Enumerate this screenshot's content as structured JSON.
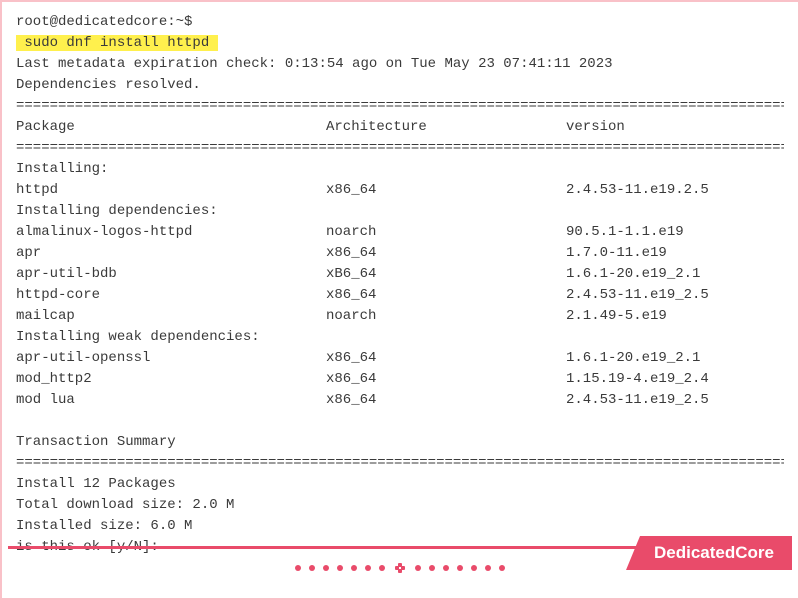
{
  "prompt": "root@dedicatedcore:~$",
  "command": " sudo dnf install httpd ",
  "meta_line": "Last metadata expiration check: 0:13:54 ago on Tue May 23 07:41:11 2023",
  "deps_resolved": "Dependencies resolved.",
  "headers": {
    "pkg": "Package",
    "arch": "Architecture",
    "ver": "version"
  },
  "sections": {
    "installing": "Installing:",
    "installing_deps": "Installing dependencies:",
    "installing_weak": "Installing weak dependencies:"
  },
  "rows_main": [
    {
      "pkg": "httpd",
      "arch": "x86_64",
      "ver": "2.4.53-11.e19.2.5"
    }
  ],
  "rows_deps": [
    {
      "pkg": "almalinux-logos-httpd",
      "arch": "noarch",
      "ver": "90.5.1-1.1.e19"
    },
    {
      "pkg": "apr",
      "arch": "x86_64",
      "ver": "1.7.0-11.e19"
    },
    {
      "pkg": "apr-util-bdb",
      "arch": "xB6_64",
      "ver": "1.6.1-20.e19_2.1"
    },
    {
      "pkg": "httpd-core",
      "arch": "x86_64",
      "ver": "2.4.53-11.e19_2.5"
    },
    {
      "pkg": "mailcap",
      "arch": "noarch",
      "ver": "2.1.49-5.e19"
    }
  ],
  "rows_weak": [
    {
      "pkg": "apr-util-openssl",
      "arch": "x86_64",
      "ver": "1.6.1-20.e19_2.1"
    },
    {
      "pkg": "mod_http2",
      "arch": "x86_64",
      "ver": "1.15.19-4.e19_2.4"
    },
    {
      "pkg": "mod lua",
      "arch": "x86_64",
      "ver": "2.4.53-11.e19_2.5"
    }
  ],
  "tx_summary": "Transaction Summary",
  "summary": {
    "install": "Install 12 Packages",
    "download": "Total download size: 2.0 M",
    "installed": "Installed size: 6.0 M",
    "prompt": "is this ok [y/N]:"
  },
  "badge": "DedicatedCore",
  "divider": "============================================================================================"
}
